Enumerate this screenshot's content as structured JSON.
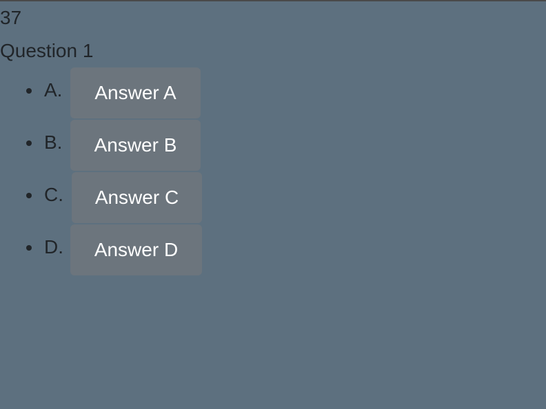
{
  "score": "37",
  "question": "Question 1",
  "answers": [
    {
      "letter": "A.",
      "label": "Answer A"
    },
    {
      "letter": "B.",
      "label": "Answer B"
    },
    {
      "letter": "C.",
      "label": "Answer C"
    },
    {
      "letter": "D.",
      "label": "Answer D"
    }
  ]
}
